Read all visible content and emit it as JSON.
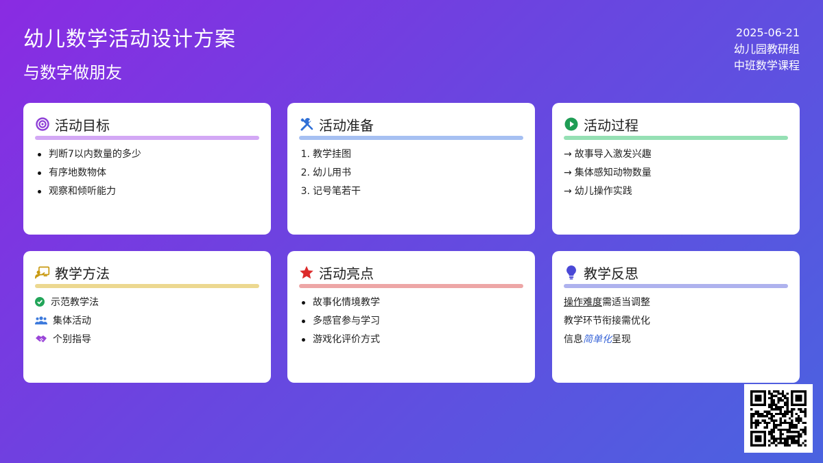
{
  "header": {
    "title": "幼儿数学活动设计方案",
    "subtitle": "与数字做朋友",
    "date": "2025-06-21",
    "org": "幼儿园教研组",
    "course": "中班数学课程"
  },
  "cards": {
    "goals": {
      "title": "活动目标",
      "icon": "target-icon",
      "color": "#d3a8f5",
      "items": [
        "判断7以内数量的多少",
        "有序地数物体",
        "观察和倾听能力"
      ]
    },
    "prep": {
      "title": "活动准备",
      "icon": "tools-icon",
      "color": "#a6c0f2",
      "items": [
        "教学挂图",
        "幼儿用书",
        "记号笔若干"
      ],
      "numbers": [
        "1.",
        "2.",
        "3."
      ]
    },
    "process": {
      "title": "活动过程",
      "icon": "play-icon",
      "color": "#95e0b4",
      "arrow": "→",
      "items": [
        "故事导入激发兴趣",
        "集体感知动物数量",
        "幼儿操作实践"
      ]
    },
    "methods": {
      "title": "教学方法",
      "icon": "teacher-icon",
      "color": "#ecd890",
      "items": [
        "示范教学法",
        "集体活动",
        "个别指导"
      ],
      "item_icons": [
        "check-circle-icon",
        "users-icon",
        "handshake-icon"
      ]
    },
    "highlights": {
      "title": "活动亮点",
      "icon": "star-icon",
      "color": "#eda6a6",
      "items": [
        "故事化情境教学",
        "多感官参与学习",
        "游戏化评价方式"
      ]
    },
    "reflection": {
      "title": "教学反思",
      "icon": "lightbulb-icon",
      "color": "#aeb2ee",
      "item1_u": "操作难度",
      "item1_rest": "需适当调整",
      "item2": "教学环节衔接需优化",
      "item3_pre": "信息",
      "item3_em": "简单化",
      "item3_post": "呈现"
    }
  },
  "qr": {
    "icon": "qr-code-icon"
  }
}
